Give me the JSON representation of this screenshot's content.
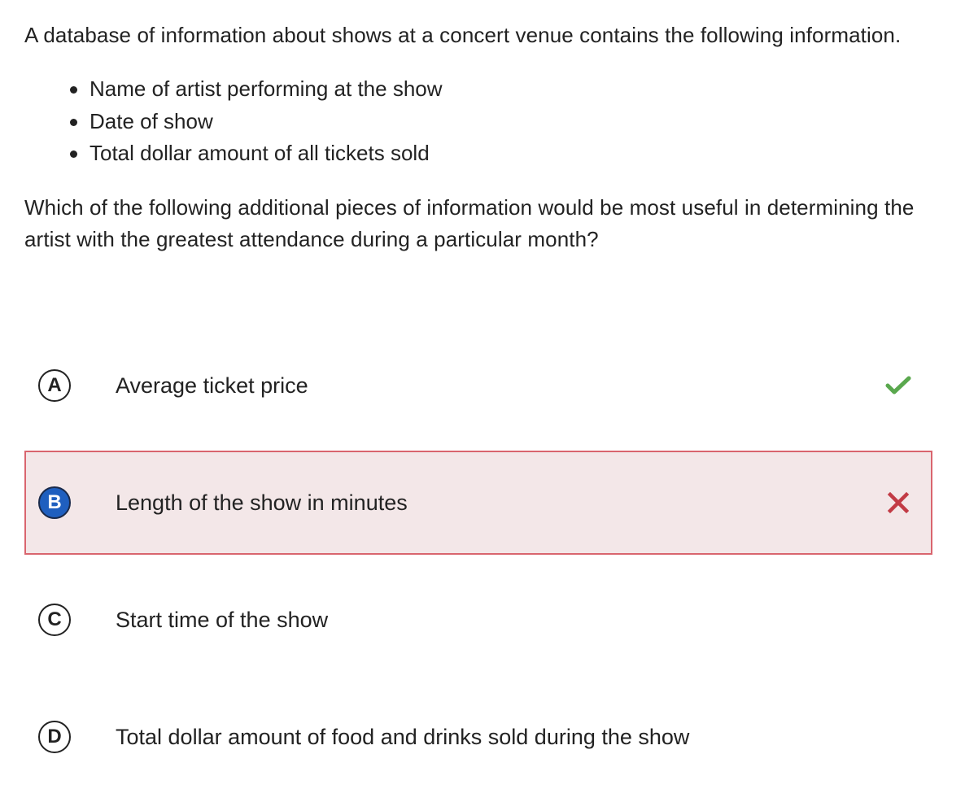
{
  "question": {
    "intro": "A database of information about shows at a concert venue contains the following information.",
    "bullets": [
      "Name of artist performing at the show",
      "Date of show",
      "Total dollar amount of all tickets sold"
    ],
    "prompt": "Which of the following additional pieces of information would be most useful in determining the artist with the greatest attendance during a particular month?"
  },
  "choices": [
    {
      "letter": "A",
      "text": "Average ticket price",
      "status": "correct",
      "icon": "checkmark-icon"
    },
    {
      "letter": "B",
      "text": "Length of the show in minutes",
      "status": "selected-incorrect",
      "icon": "x-mark-icon"
    },
    {
      "letter": "C",
      "text": "Start time of the show",
      "status": "none"
    },
    {
      "letter": "D",
      "text": "Total dollar amount of food and drinks sold during the show",
      "status": "none"
    }
  ],
  "colors": {
    "correct": "#5aa84e",
    "incorrect": "#c23b45",
    "selected_background": "#f3e7e8",
    "selected_border": "#d9656e",
    "selected_badge": "#1f5fbf"
  }
}
